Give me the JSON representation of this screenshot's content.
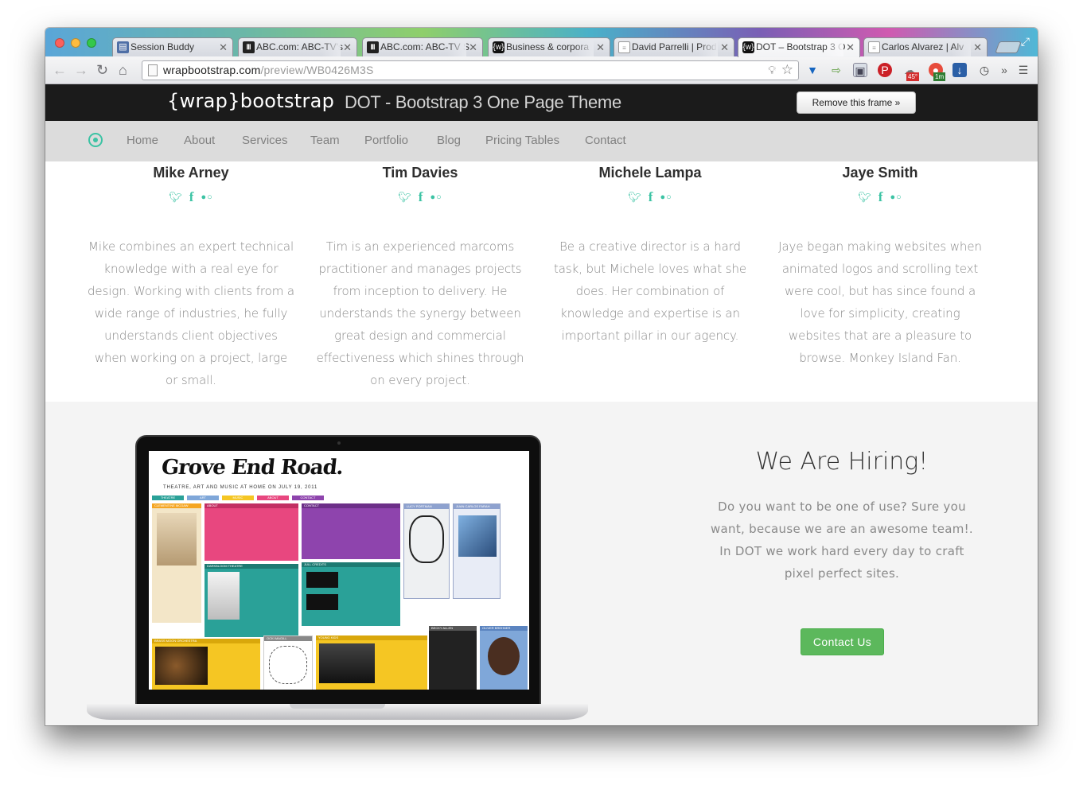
{
  "browser": {
    "tabs": [
      {
        "title": "Session Buddy",
        "icon": "session-buddy-icon"
      },
      {
        "title": "ABC.com: ABC-TV's",
        "icon": "abc-icon"
      },
      {
        "title": "ABC.com: ABC-TV S",
        "icon": "abc-icon"
      },
      {
        "title": "Business & corpora",
        "icon": "wrapbootstrap-icon"
      },
      {
        "title": "David Parrelli | Prod",
        "icon": "document-icon"
      },
      {
        "title": "DOT – Bootstrap 3 O",
        "icon": "wrapbootstrap-icon"
      },
      {
        "title": "Carlos Alvarez | Alv",
        "icon": "document-icon"
      }
    ],
    "url_host": "wrapbootstrap.com",
    "url_path": "/preview/WB0426M3S",
    "extension_badges": {
      "weather": "45°",
      "timer": "1m"
    }
  },
  "frame_banner": {
    "logo_left": "{wrap}",
    "logo_right": "bootstrap",
    "theme_title": "DOT - Bootstrap 3 One Page Theme",
    "remove_label": "Remove this frame »"
  },
  "site_nav": {
    "items": [
      "Home",
      "About",
      "Services",
      "Team",
      "Portfolio",
      "Blog",
      "Pricing Tables",
      "Contact"
    ]
  },
  "team": [
    {
      "name": "Mike Arney",
      "bio": "Mike combines an expert technical knowledge with a real eye for design. Working with clients from a wide range of industries, he fully understands client objectives when working on a project, large or small."
    },
    {
      "name": "Tim Davies",
      "bio": "Tim is an experienced marcoms practitioner and manages projects from inception to delivery. He understands the synergy between great design and commercial effectiveness which shines through on every project."
    },
    {
      "name": "Michele Lampa",
      "bio": "Be a creative director is a hard task, but Michele loves what she does. Her combination of knowledge and expertise is an important pillar in our agency."
    },
    {
      "name": "Jaye Smith",
      "bio": "Jaye began making websites when animated logos and scrolling text were cool, but has since found a love for simplicity, creating websites that are a pleasure to browse. Monkey Island Fan."
    }
  ],
  "social_icons": [
    "twitter-icon",
    "facebook-icon",
    "flickr-icon"
  ],
  "hiring": {
    "title": "We Are Hiring!",
    "text": "Do you want to be one of use? Sure you want, because we are an awesome team!. In DOT we work hard every day to craft pixel perfect sites.",
    "button": "Contact Us"
  },
  "laptop_screen": {
    "title": "Grove End Road.",
    "subtitle": "THEATRE, ART AND MUSIC AT HOME ON JULY 19, 2011",
    "tabs": [
      "THEATRE",
      "ART",
      "MUSIC",
      "ABOUT",
      "CONTACT"
    ],
    "blocks": [
      "CLEMENTINE MCGAW",
      "ABOUT",
      "CONTACT",
      "LUCY PORTMAN",
      "JUAN CARLOS FARAH",
      "DARKBLOOM THEATRE",
      "JULL CREDITS",
      "BRASS MOON ORCHESTRA",
      "OCKI MAGILL",
      "YOUNG KIDS",
      "BECKY ALLEN",
      "OLIVER BREHNER"
    ]
  },
  "colors": {
    "accent": "#3cc3a4",
    "contact_button": "#5cb85c",
    "screen_pink": "#e8477f",
    "screen_teal": "#2aa198",
    "screen_purple": "#8e44ad",
    "screen_orange": "#f5a623"
  }
}
